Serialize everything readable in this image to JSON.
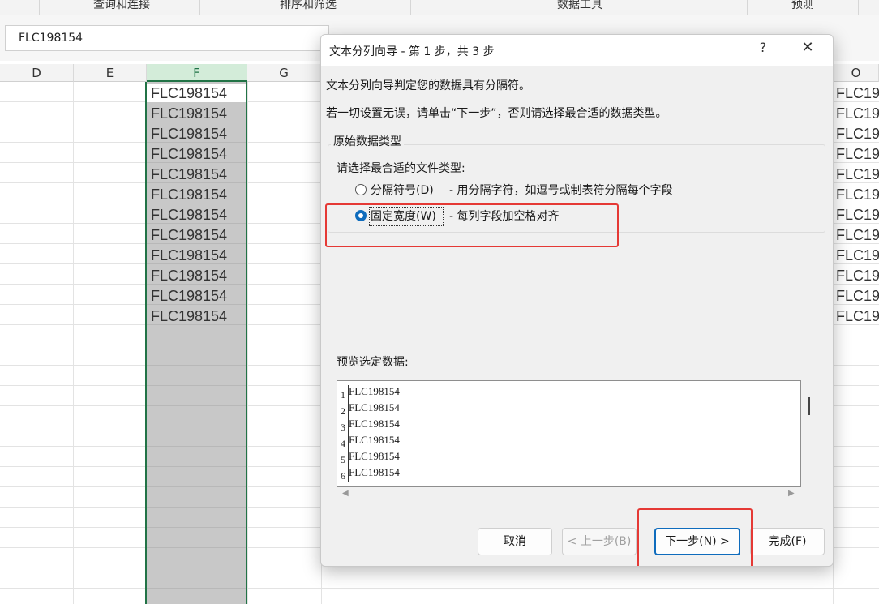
{
  "ribbon": {
    "groups": [
      "查询和连接",
      "排序和筛选",
      "数据工具",
      "预测"
    ]
  },
  "namebox": {
    "value": "FLC198154"
  },
  "columns": [
    "D",
    "E",
    "F",
    "G",
    "O"
  ],
  "cells": {
    "F": [
      "FLC198154",
      "FLC198154",
      "FLC198154",
      "FLC198154",
      "FLC198154",
      "FLC198154",
      "FLC198154",
      "FLC198154",
      "FLC198154",
      "FLC198154",
      "FLC198154",
      "FLC198154"
    ],
    "O": [
      "FLC19",
      "FLC19",
      "FLC19",
      "FLC19",
      "FLC19",
      "FLC19",
      "FLC19",
      "FLC19",
      "FLC19",
      "FLC19",
      "FLC19",
      "FLC19"
    ]
  },
  "dialog": {
    "title": "文本分列向导 - 第 1 步，共 3 步",
    "help": "?",
    "close": "✕",
    "intro1": "文本分列向导判定您的数据具有分隔符。",
    "intro2": "若一切设置无误，请单击“下一步”，否则请选择最合适的数据类型。",
    "group_label": "原始数据类型",
    "choose_label": "请选择最合适的文件类型:",
    "opt1": {
      "label": "分隔符号(",
      "key": "D",
      "end": ")",
      "desc": "- 用分隔字符，如逗号或制表符分隔每个字段",
      "selected": false
    },
    "opt2": {
      "label": "固定宽度(",
      "key": "W",
      "end": ")",
      "desc": "- 每列字段加空格对齐",
      "selected": true
    },
    "preview_label": "预览选定数据:",
    "preview_nums": [
      "1",
      "2",
      "3",
      "4",
      "5",
      "6"
    ],
    "preview_lines": [
      "FLC198154",
      "FLC198154",
      "FLC198154",
      "FLC198154",
      "FLC198154",
      "FLC198154"
    ],
    "buttons": {
      "cancel": "取消",
      "back": "< 上一步(B)",
      "next_a": "下一步(",
      "next_key": "N",
      "next_b": ") >",
      "finish_a": "完成(",
      "finish_key": "F",
      "finish_b": ")"
    }
  },
  "colors": {
    "accent": "#0f6cbd",
    "excel_green": "#217346",
    "highlight": "#e53935"
  }
}
